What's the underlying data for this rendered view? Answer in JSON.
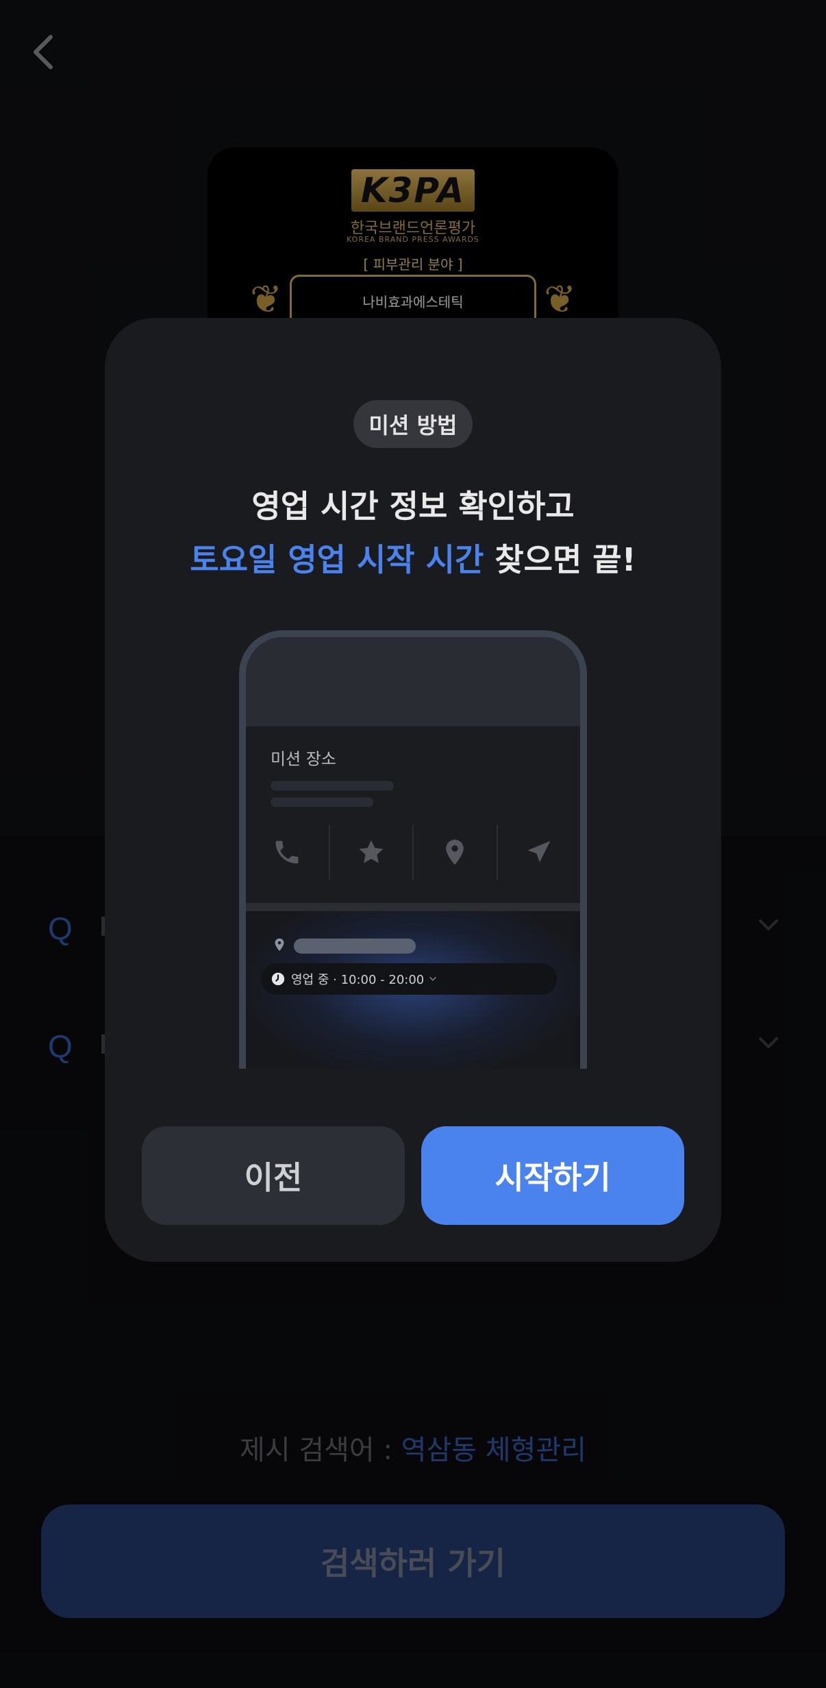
{
  "colors": {
    "accent": "#4a82ee",
    "modal_bg": "#1a1b1f",
    "go_button_bg": "#22386a"
  },
  "header": {
    "back_icon": "chevron-left-icon"
  },
  "banner": {
    "logo_text": "K3PA",
    "subtitle_ko": "한국브랜드언론평가",
    "subtitle_en": "KOREA BRAND PRESS AWARDS",
    "category": "[ 피부관리 분야 ]",
    "name": "나비효과에스테틱"
  },
  "background_rows": [
    {
      "icon": "search-icon",
      "label": "Q",
      "chevron": "chevron-down-icon"
    },
    {
      "icon": "search-icon",
      "label": "Q",
      "chevron": "chevron-down-icon"
    }
  ],
  "modal": {
    "pill_label": "미션 방법",
    "headline_line1": "영업 시간 정보 확인하고",
    "headline_accent": "토요일 영업 시작 시간",
    "headline_rest": " 찾으면 끝!",
    "illustration": {
      "card_title": "미션 장소",
      "action_icons": [
        "phone-icon",
        "star-icon",
        "location-pin-icon",
        "send-icon"
      ],
      "hours_text": "영업 중 · 10:00 - 20:00"
    },
    "prev_label": "이전",
    "start_label": "시작하기"
  },
  "footer": {
    "suggest_prefix": "제시 검색어 : ",
    "suggest_keyword": "역삼동 체형관리",
    "go_label": "검색하러 가기"
  }
}
